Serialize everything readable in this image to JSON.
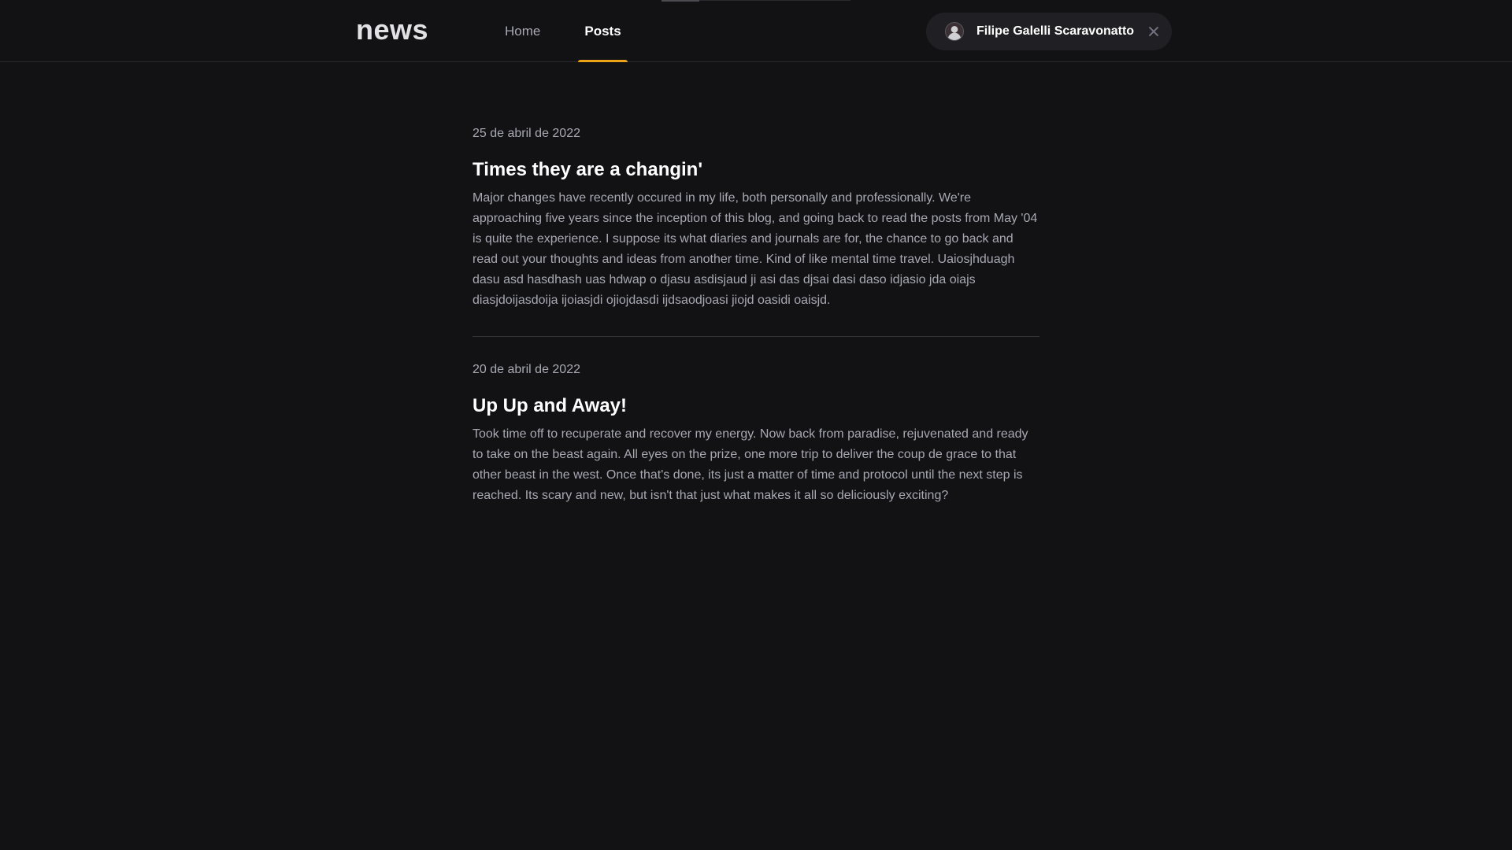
{
  "header": {
    "logo": "news",
    "nav": [
      {
        "label": "Home",
        "active": false
      },
      {
        "label": "Posts",
        "active": true
      }
    ],
    "user": {
      "name": "Filipe Galelli Scaravonatto",
      "avatar_icon": "user-avatar",
      "close_icon": "close-icon"
    }
  },
  "posts": [
    {
      "date": "25 de abril de 2022",
      "title": "Times they are a changin'",
      "excerpt": "Major changes have recently occured in my life, both personally and professionally. We're approaching five years since the inception of this blog, and going back to read the posts from May '04 is quite the experience. I suppose its what diaries and journals are for, the chance to go back and read out your thoughts and ideas from another time. Kind of like mental time travel. Uaiosjhduagh dasu asd hasdhash uas hdwap o djasu asdisjaud ji asi das djsai dasi daso idjasio jda oiajs diasjdoijasdoija ijoiasjdi ojiojdasdi ijdsaodjoasi jiojd oasidi oaisjd."
    },
    {
      "date": "20 de abril de 2022",
      "title": "Up Up and Away!",
      "excerpt": "Took time off to recuperate and recover my energy. Now back from paradise, rejuvenated and ready to take on the beast again. All eyes on the prize, one more trip to deliver the coup de grace to that other beast in the west. Once that's done, its just a matter of time and protocol until the next step is reached. Its scary and new, but isn't that just what makes it all so deliciously exciting?"
    }
  ],
  "colors": {
    "background": "#121214",
    "accent": "#eba417",
    "text_primary": "#ffffff",
    "text_secondary": "#a8a8b3"
  }
}
